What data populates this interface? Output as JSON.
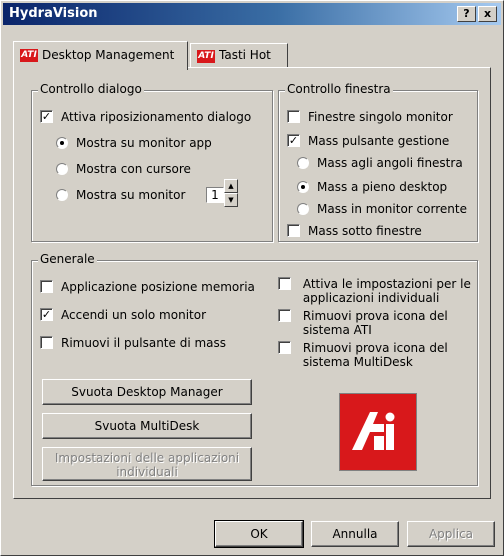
{
  "window": {
    "title": "HydraVision",
    "help_label": "?",
    "close_label": "x"
  },
  "tabs": [
    {
      "label": "Desktop Management",
      "icon": "ati-logo-icon",
      "active": true
    },
    {
      "label": "Tasti Hot",
      "icon": "ati-logo-icon",
      "active": false
    }
  ],
  "dialog_control": {
    "title": "Controllo dialogo",
    "enable_label": "Attiva riposizionamento dialogo",
    "enable_checked": true,
    "radio_app": "Mostra su monitor app",
    "radio_cursor": "Mostra con cursore",
    "radio_monitor": "Mostra su monitor",
    "selected": "app",
    "monitor_number": "1"
  },
  "window_control": {
    "title": "Controllo finestra",
    "single_monitor": "Finestre singolo monitor",
    "single_monitor_checked": false,
    "max_button": "Mass pulsante gestione",
    "max_button_checked": true,
    "radio_corners": "Mass agli angoli finestra",
    "radio_full": "Mass a pieno desktop",
    "radio_current": "Mass in monitor corrente",
    "selected": "full",
    "max_below": "Mass sotto finestre",
    "max_below_checked": false
  },
  "general": {
    "title": "Generale",
    "memory_pos": "Applicazione posizione memoria",
    "memory_pos_checked": false,
    "one_monitor": "Accendi un solo monitor",
    "one_monitor_checked": true,
    "remove_max": "Rimuovi il pulsante di mass",
    "remove_max_checked": false,
    "enable_per_app_line1": "Attiva le impostazioni per le",
    "enable_per_app_line2": "applicazioni individuali",
    "remove_ati_line1": "Rimuovi prova icona del",
    "remove_ati_line2": "sistema ATI",
    "remove_multidesk_line1": "Rimuovi prova icona del",
    "remove_multidesk_line2": "sistema MultiDesk",
    "btn_desktop_manager": "Svuota Desktop Manager",
    "btn_multidesk": "Svuota MultiDesk",
    "btn_app_settings_line1": "Impostazioni delle applicazioni",
    "btn_app_settings_line2": "individuali",
    "logo_text": "ATi"
  },
  "footer": {
    "ok": "OK",
    "cancel": "Annulla",
    "apply": "Applica"
  },
  "colors": {
    "titlebar_start": "#0a246a",
    "titlebar_end": "#a6caf0",
    "face": "#d4d0c8",
    "ati_red": "#d8181b"
  }
}
